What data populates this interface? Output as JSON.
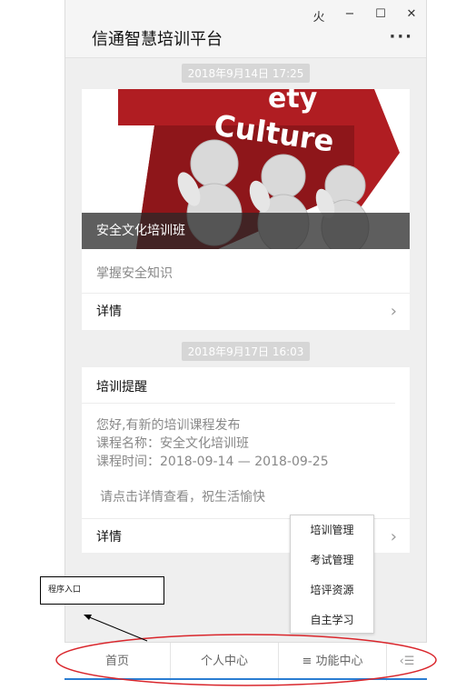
{
  "window": {
    "controls": [
      "⽕",
      "−",
      "☐",
      "✕"
    ],
    "title": "信通智慧培训平台",
    "more": "···"
  },
  "feed": {
    "msg1": {
      "timestamp": "2018年9月14日 17:25",
      "image_text_1": "ety",
      "image_text_2": "Culture",
      "caption": "安全文化培训班",
      "summary": "掌握安全知识",
      "details_label": "详情"
    },
    "msg2": {
      "timestamp": "2018年9月17日 16:03",
      "heading": "培训提醒",
      "line1": "您好,有新的培训课程发布",
      "line2": "课程名称：安全文化培训班",
      "line3": "课程时间：2018-09-14 — 2018-09-25",
      "note": "请点击详情查看，祝生活愉快",
      "details_label": "详情"
    }
  },
  "popup_menu": {
    "items": [
      "培训管理",
      "考试管理",
      "培评资源",
      "自主学习"
    ]
  },
  "tabbar": {
    "home": "首页",
    "profile": "个人中心",
    "functions_icon": "≡",
    "functions": "功能中心",
    "keyboard_icon": "‹☰"
  },
  "annotation": {
    "label": "程序入口"
  },
  "colors": {
    "accent": "#2a7dd2",
    "annotation_ellipse": "#d9262c",
    "hero_red": "#b01d22"
  }
}
